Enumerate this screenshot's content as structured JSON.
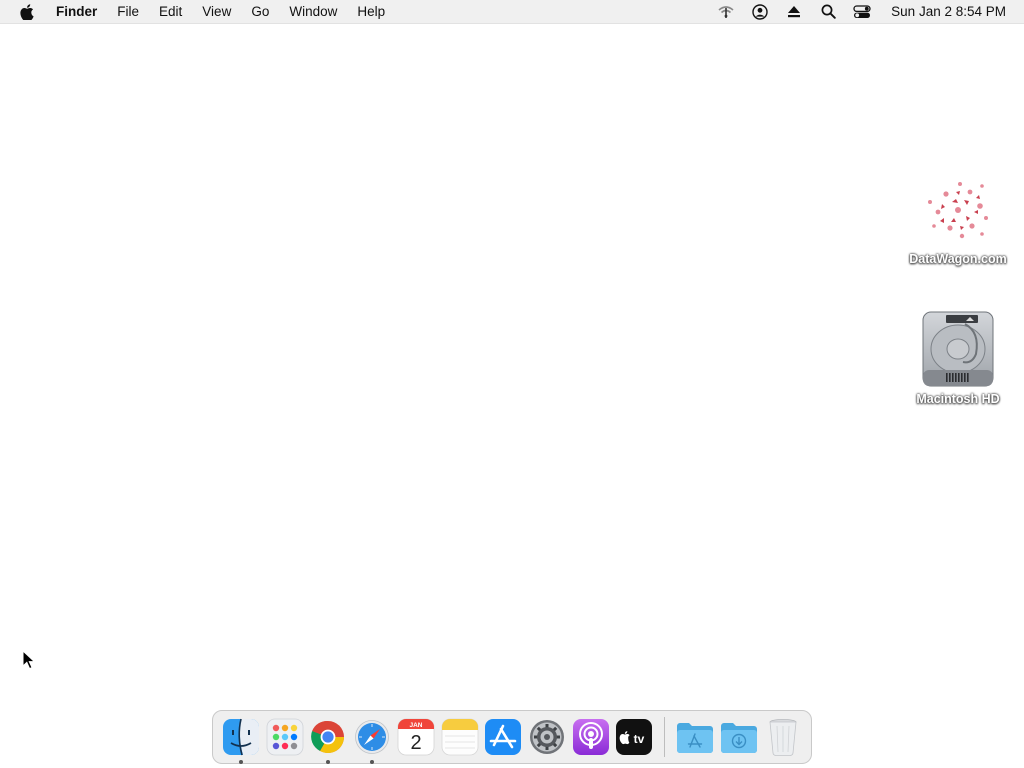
{
  "menubar": {
    "app_name": "Finder",
    "items": [
      "File",
      "Edit",
      "View",
      "Go",
      "Window",
      "Help"
    ],
    "status_icons": [
      "wifi-off-icon",
      "user-account-icon",
      "eject-icon",
      "spotlight-search-icon",
      "control-center-icon"
    ],
    "clock": "Sun Jan 2  8:54 PM"
  },
  "desktop": {
    "icons": [
      {
        "label": "DataWagon.com",
        "icon": "datawagon-file-icon"
      },
      {
        "label": "Macintosh HD",
        "icon": "hard-drive-icon"
      }
    ]
  },
  "dock": {
    "apps": [
      {
        "name": "finder",
        "icon": "finder-icon",
        "running": true
      },
      {
        "name": "launchpad",
        "icon": "launchpad-icon",
        "running": false
      },
      {
        "name": "chrome",
        "icon": "chrome-icon",
        "running": true
      },
      {
        "name": "safari",
        "icon": "safari-icon",
        "running": true
      },
      {
        "name": "calendar",
        "icon": "calendar-icon",
        "running": false,
        "month": "JAN",
        "day": "2"
      },
      {
        "name": "notes",
        "icon": "notes-icon",
        "running": false
      },
      {
        "name": "app-store",
        "icon": "app-store-icon",
        "running": false
      },
      {
        "name": "system-preferences",
        "icon": "gear-icon",
        "running": false
      },
      {
        "name": "podcasts",
        "icon": "podcasts-icon",
        "running": false
      },
      {
        "name": "apple-tv",
        "icon": "apple-tv-icon",
        "running": false,
        "text": "tv"
      }
    ],
    "stacks": [
      {
        "name": "applications",
        "icon": "applications-folder-icon"
      },
      {
        "name": "downloads",
        "icon": "downloads-folder-icon"
      },
      {
        "name": "trash",
        "icon": "trash-icon"
      }
    ]
  },
  "colors": {
    "menubar_bg": "#f0f0f0",
    "desktop_bg": "#ffffff",
    "dock_bg": "#ececec",
    "folder_blue": "#5ab6ea"
  }
}
